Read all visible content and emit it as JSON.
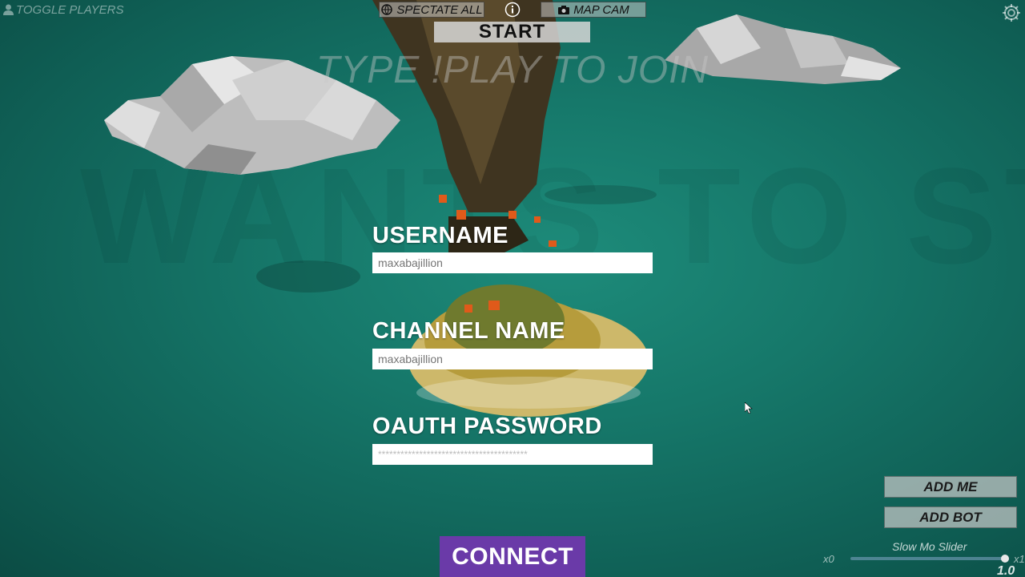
{
  "top_bar": {
    "toggle_players_label": "TOGGLE PLAYERS",
    "toggle_players_icon": "person-icon",
    "spectate_label": "SPECTATE ALL",
    "spectate_icon": "globe-icon",
    "info_icon": "info-icon",
    "map_cam_label": "MAP CAM",
    "map_cam_icon": "camera-icon",
    "settings_icon": "gear-icon"
  },
  "start_label": "START",
  "join_prompt": "TYPE !PLAY TO JOIN",
  "watermark": "WANTS TO START",
  "form": {
    "username_label": "USERNAME",
    "username_placeholder": "maxabajillion",
    "channel_label": "CHANNEL NAME",
    "channel_placeholder": "maxabajillion",
    "oauth_label": "OAUTH PASSWORD",
    "oauth_value": "****************************************"
  },
  "connect_label": "CONNECT",
  "side_panel": {
    "add_me_label": "ADD ME",
    "add_bot_label": "ADD BOT"
  },
  "slow_mo": {
    "label": "Slow Mo Slider",
    "min_label": "x0",
    "max_label": "x1",
    "value_text": "1.0",
    "level": 1.0
  },
  "colors": {
    "background": "#16786a",
    "connect_button": "#6a3aa8",
    "input_background": "#ffffff"
  }
}
